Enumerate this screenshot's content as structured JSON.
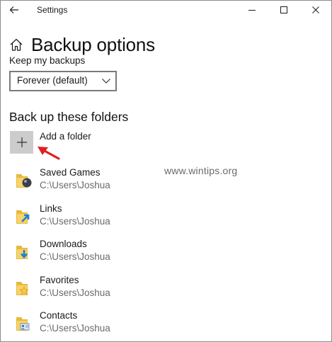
{
  "window": {
    "title": "Settings",
    "controls": [
      "minimize-icon",
      "maximize-icon",
      "close-icon"
    ]
  },
  "header": {
    "title": "Backup options"
  },
  "keep_backups": {
    "label": "Keep my backups",
    "selected": "Forever (default)"
  },
  "folders_section": {
    "title": "Back up these folders",
    "add_label": "Add a folder"
  },
  "folders": [
    {
      "name": "Saved Games",
      "path": "C:\\Users\\Joshua",
      "icon": "saved-games-folder-icon"
    },
    {
      "name": "Links",
      "path": "C:\\Users\\Joshua",
      "icon": "links-folder-icon"
    },
    {
      "name": "Downloads",
      "path": "C:\\Users\\Joshua",
      "icon": "downloads-folder-icon"
    },
    {
      "name": "Favorites",
      "path": "C:\\Users\\Joshua",
      "icon": "favorites-folder-icon"
    },
    {
      "name": "Contacts",
      "path": "C:\\Users\\Joshua",
      "icon": "contacts-folder-icon"
    }
  ],
  "watermark": "www.wintips.org",
  "colors": {
    "accent_arrow": "#e02020",
    "folder_yellow": "#f2c94c",
    "add_tile": "#cccccc"
  }
}
